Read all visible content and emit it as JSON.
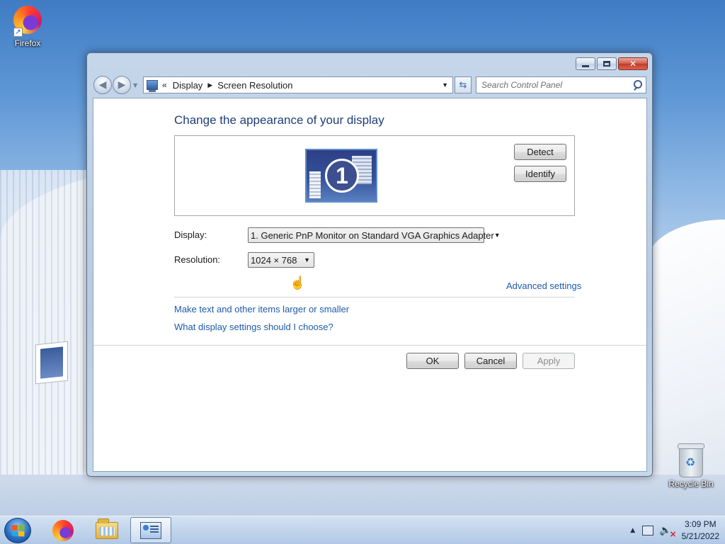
{
  "desktop": {
    "icons": [
      {
        "label": "Firefox",
        "icon": "firefox-icon"
      },
      {
        "label": "Recycle Bin",
        "icon": "recycle-bin-icon"
      }
    ]
  },
  "window": {
    "address": {
      "crumb_prefix": "«",
      "crumbs": [
        "Display",
        "Screen Resolution"
      ]
    },
    "search": {
      "placeholder": "Search Control Panel"
    },
    "content": {
      "heading": "Change the appearance of your display",
      "monitor_number": "1",
      "detect_label": "Detect",
      "identify_label": "Identify",
      "display_label": "Display:",
      "display_value": "1. Generic PnP Monitor on Standard VGA Graphics Adapter",
      "resolution_label": "Resolution:",
      "resolution_value": "1024 × 768",
      "advanced_link": "Advanced settings",
      "links": [
        "Make text and other items larger or smaller",
        "What display settings should I choose?"
      ],
      "ok_label": "OK",
      "cancel_label": "Cancel",
      "apply_label": "Apply"
    }
  },
  "taskbar": {
    "clock_time": "3:09 PM",
    "clock_date": "5/21/2022"
  },
  "colors": {
    "heading": "#1e3e78",
    "link": "#1d5aab",
    "window_frame": "#b8cbe2"
  }
}
